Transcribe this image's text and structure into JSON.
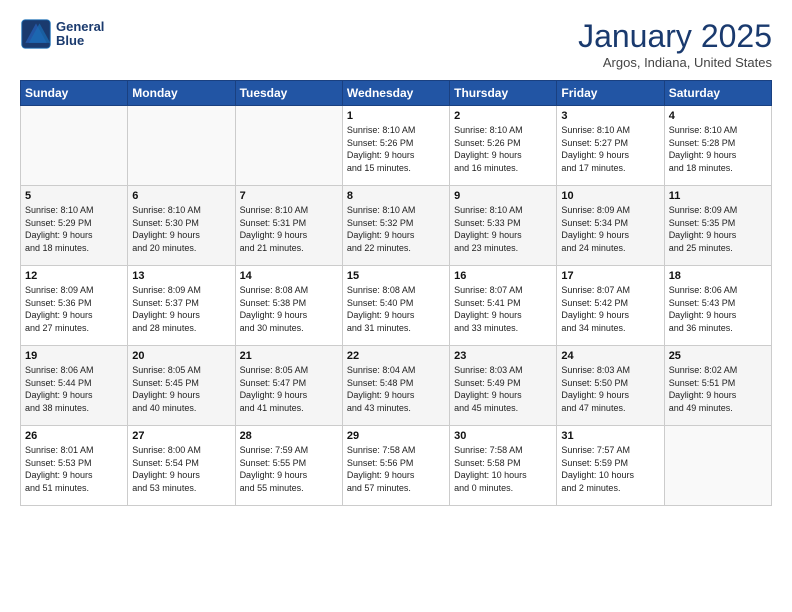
{
  "header": {
    "logo_line1": "General",
    "logo_line2": "Blue",
    "month": "January 2025",
    "location": "Argos, Indiana, United States"
  },
  "weekdays": [
    "Sunday",
    "Monday",
    "Tuesday",
    "Wednesday",
    "Thursday",
    "Friday",
    "Saturday"
  ],
  "weeks": [
    [
      {
        "day": "",
        "content": ""
      },
      {
        "day": "",
        "content": ""
      },
      {
        "day": "",
        "content": ""
      },
      {
        "day": "1",
        "content": "Sunrise: 8:10 AM\nSunset: 5:26 PM\nDaylight: 9 hours\nand 15 minutes."
      },
      {
        "day": "2",
        "content": "Sunrise: 8:10 AM\nSunset: 5:26 PM\nDaylight: 9 hours\nand 16 minutes."
      },
      {
        "day": "3",
        "content": "Sunrise: 8:10 AM\nSunset: 5:27 PM\nDaylight: 9 hours\nand 17 minutes."
      },
      {
        "day": "4",
        "content": "Sunrise: 8:10 AM\nSunset: 5:28 PM\nDaylight: 9 hours\nand 18 minutes."
      }
    ],
    [
      {
        "day": "5",
        "content": "Sunrise: 8:10 AM\nSunset: 5:29 PM\nDaylight: 9 hours\nand 18 minutes."
      },
      {
        "day": "6",
        "content": "Sunrise: 8:10 AM\nSunset: 5:30 PM\nDaylight: 9 hours\nand 20 minutes."
      },
      {
        "day": "7",
        "content": "Sunrise: 8:10 AM\nSunset: 5:31 PM\nDaylight: 9 hours\nand 21 minutes."
      },
      {
        "day": "8",
        "content": "Sunrise: 8:10 AM\nSunset: 5:32 PM\nDaylight: 9 hours\nand 22 minutes."
      },
      {
        "day": "9",
        "content": "Sunrise: 8:10 AM\nSunset: 5:33 PM\nDaylight: 9 hours\nand 23 minutes."
      },
      {
        "day": "10",
        "content": "Sunrise: 8:09 AM\nSunset: 5:34 PM\nDaylight: 9 hours\nand 24 minutes."
      },
      {
        "day": "11",
        "content": "Sunrise: 8:09 AM\nSunset: 5:35 PM\nDaylight: 9 hours\nand 25 minutes."
      }
    ],
    [
      {
        "day": "12",
        "content": "Sunrise: 8:09 AM\nSunset: 5:36 PM\nDaylight: 9 hours\nand 27 minutes."
      },
      {
        "day": "13",
        "content": "Sunrise: 8:09 AM\nSunset: 5:37 PM\nDaylight: 9 hours\nand 28 minutes."
      },
      {
        "day": "14",
        "content": "Sunrise: 8:08 AM\nSunset: 5:38 PM\nDaylight: 9 hours\nand 30 minutes."
      },
      {
        "day": "15",
        "content": "Sunrise: 8:08 AM\nSunset: 5:40 PM\nDaylight: 9 hours\nand 31 minutes."
      },
      {
        "day": "16",
        "content": "Sunrise: 8:07 AM\nSunset: 5:41 PM\nDaylight: 9 hours\nand 33 minutes."
      },
      {
        "day": "17",
        "content": "Sunrise: 8:07 AM\nSunset: 5:42 PM\nDaylight: 9 hours\nand 34 minutes."
      },
      {
        "day": "18",
        "content": "Sunrise: 8:06 AM\nSunset: 5:43 PM\nDaylight: 9 hours\nand 36 minutes."
      }
    ],
    [
      {
        "day": "19",
        "content": "Sunrise: 8:06 AM\nSunset: 5:44 PM\nDaylight: 9 hours\nand 38 minutes."
      },
      {
        "day": "20",
        "content": "Sunrise: 8:05 AM\nSunset: 5:45 PM\nDaylight: 9 hours\nand 40 minutes."
      },
      {
        "day": "21",
        "content": "Sunrise: 8:05 AM\nSunset: 5:47 PM\nDaylight: 9 hours\nand 41 minutes."
      },
      {
        "day": "22",
        "content": "Sunrise: 8:04 AM\nSunset: 5:48 PM\nDaylight: 9 hours\nand 43 minutes."
      },
      {
        "day": "23",
        "content": "Sunrise: 8:03 AM\nSunset: 5:49 PM\nDaylight: 9 hours\nand 45 minutes."
      },
      {
        "day": "24",
        "content": "Sunrise: 8:03 AM\nSunset: 5:50 PM\nDaylight: 9 hours\nand 47 minutes."
      },
      {
        "day": "25",
        "content": "Sunrise: 8:02 AM\nSunset: 5:51 PM\nDaylight: 9 hours\nand 49 minutes."
      }
    ],
    [
      {
        "day": "26",
        "content": "Sunrise: 8:01 AM\nSunset: 5:53 PM\nDaylight: 9 hours\nand 51 minutes."
      },
      {
        "day": "27",
        "content": "Sunrise: 8:00 AM\nSunset: 5:54 PM\nDaylight: 9 hours\nand 53 minutes."
      },
      {
        "day": "28",
        "content": "Sunrise: 7:59 AM\nSunset: 5:55 PM\nDaylight: 9 hours\nand 55 minutes."
      },
      {
        "day": "29",
        "content": "Sunrise: 7:58 AM\nSunset: 5:56 PM\nDaylight: 9 hours\nand 57 minutes."
      },
      {
        "day": "30",
        "content": "Sunrise: 7:58 AM\nSunset: 5:58 PM\nDaylight: 10 hours\nand 0 minutes."
      },
      {
        "day": "31",
        "content": "Sunrise: 7:57 AM\nSunset: 5:59 PM\nDaylight: 10 hours\nand 2 minutes."
      },
      {
        "day": "",
        "content": ""
      }
    ]
  ]
}
